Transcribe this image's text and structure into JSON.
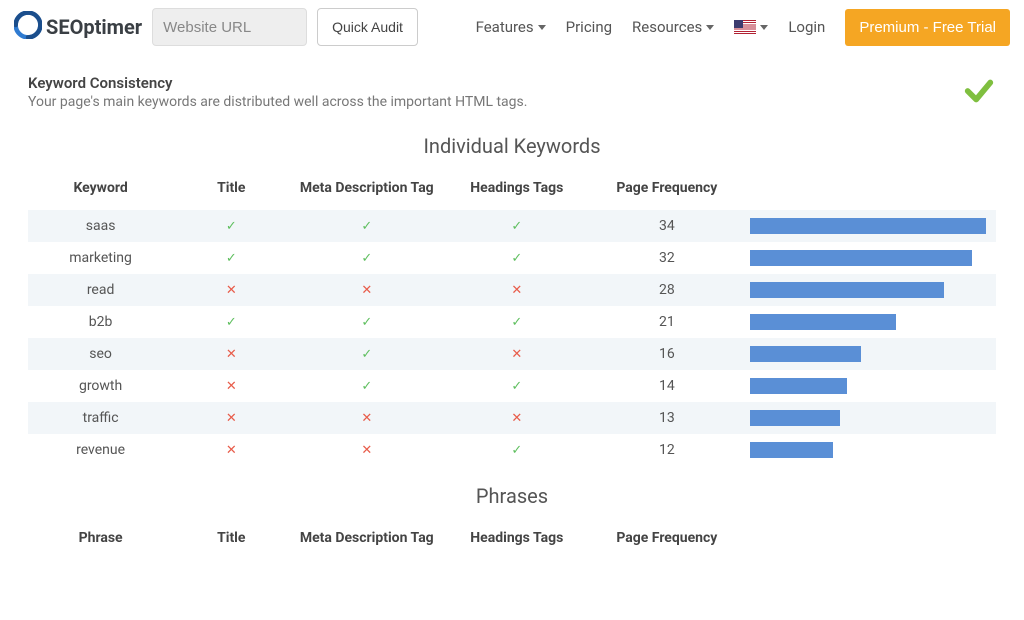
{
  "nav": {
    "logo_text": "SEOptimer",
    "url_placeholder": "Website URL",
    "audit_label": "Quick Audit",
    "features_label": "Features",
    "pricing_label": "Pricing",
    "resources_label": "Resources",
    "login_label": "Login",
    "cta_label": "Premium - Free Trial"
  },
  "section": {
    "title": "Keyword Consistency",
    "subtitle": "Your page's main keywords are distributed well across the important HTML tags."
  },
  "table1": {
    "title": "Individual Keywords",
    "headers": {
      "keyword": "Keyword",
      "title": "Title",
      "meta": "Meta Description Tag",
      "headings": "Headings Tags",
      "freq": "Page Frequency"
    },
    "rows": [
      {
        "keyword": "saas",
        "title": true,
        "meta": true,
        "headings": true,
        "freq": 34
      },
      {
        "keyword": "marketing",
        "title": true,
        "meta": true,
        "headings": true,
        "freq": 32
      },
      {
        "keyword": "read",
        "title": false,
        "meta": false,
        "headings": false,
        "freq": 28
      },
      {
        "keyword": "b2b",
        "title": true,
        "meta": true,
        "headings": true,
        "freq": 21
      },
      {
        "keyword": "seo",
        "title": false,
        "meta": true,
        "headings": false,
        "freq": 16
      },
      {
        "keyword": "growth",
        "title": false,
        "meta": true,
        "headings": true,
        "freq": 14
      },
      {
        "keyword": "traffic",
        "title": false,
        "meta": false,
        "headings": false,
        "freq": 13
      },
      {
        "keyword": "revenue",
        "title": false,
        "meta": false,
        "headings": true,
        "freq": 12
      }
    ],
    "max_freq": 34
  },
  "table2": {
    "title": "Phrases",
    "headers": {
      "phrase": "Phrase",
      "title": "Title",
      "meta": "Meta Description Tag",
      "headings": "Headings Tags",
      "freq": "Page Frequency"
    }
  },
  "chart_data": {
    "type": "bar",
    "title": "Individual Keywords — Page Frequency",
    "xlabel": "Page Frequency",
    "ylabel": "Keyword",
    "categories": [
      "saas",
      "marketing",
      "read",
      "b2b",
      "seo",
      "growth",
      "traffic",
      "revenue"
    ],
    "values": [
      34,
      32,
      28,
      21,
      16,
      14,
      13,
      12
    ],
    "ylim": [
      0,
      34
    ]
  }
}
